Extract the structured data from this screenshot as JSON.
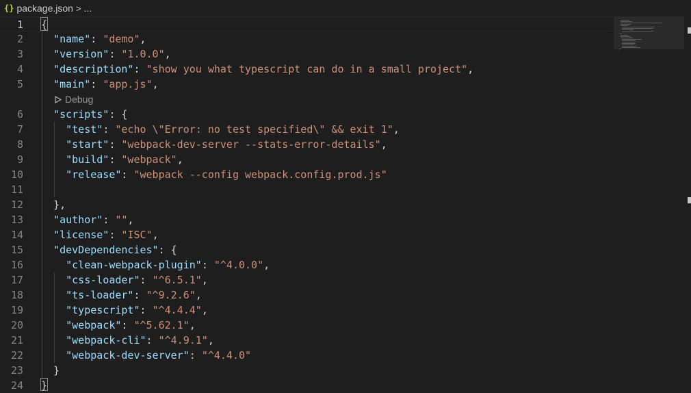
{
  "breadcrumb": {
    "file_icon": "{}",
    "file": "package.json",
    "sep": ">",
    "more": "..."
  },
  "codelens": {
    "debug": "Debug"
  },
  "lines": [
    {
      "n": "1",
      "tokens": [
        {
          "t": "p",
          "v": "{"
        }
      ]
    },
    {
      "n": "2",
      "tokens": [
        {
          "t": "p",
          "v": "  "
        },
        {
          "t": "k",
          "v": "\"name\""
        },
        {
          "t": "p",
          "v": ": "
        },
        {
          "t": "s",
          "v": "\"demo\""
        },
        {
          "t": "p",
          "v": ","
        }
      ]
    },
    {
      "n": "3",
      "tokens": [
        {
          "t": "p",
          "v": "  "
        },
        {
          "t": "k",
          "v": "\"version\""
        },
        {
          "t": "p",
          "v": ": "
        },
        {
          "t": "s",
          "v": "\"1.0.0\""
        },
        {
          "t": "p",
          "v": ","
        }
      ]
    },
    {
      "n": "4",
      "tokens": [
        {
          "t": "p",
          "v": "  "
        },
        {
          "t": "k",
          "v": "\"description\""
        },
        {
          "t": "p",
          "v": ": "
        },
        {
          "t": "s",
          "v": "\"show you what typescript can do in a small project\""
        },
        {
          "t": "p",
          "v": ","
        }
      ]
    },
    {
      "n": "5",
      "tokens": [
        {
          "t": "p",
          "v": "  "
        },
        {
          "t": "k",
          "v": "\"main\""
        },
        {
          "t": "p",
          "v": ": "
        },
        {
          "t": "s",
          "v": "\"app.js\""
        },
        {
          "t": "p",
          "v": ","
        }
      ]
    },
    {
      "n": "6",
      "tokens": [
        {
          "t": "p",
          "v": "  "
        },
        {
          "t": "k",
          "v": "\"scripts\""
        },
        {
          "t": "p",
          "v": ": {"
        }
      ]
    },
    {
      "n": "7",
      "tokens": [
        {
          "t": "p",
          "v": "    "
        },
        {
          "t": "k",
          "v": "\"test\""
        },
        {
          "t": "p",
          "v": ": "
        },
        {
          "t": "s",
          "v": "\"echo \\\"Error: no test specified\\\" && exit 1\""
        },
        {
          "t": "p",
          "v": ","
        }
      ]
    },
    {
      "n": "8",
      "tokens": [
        {
          "t": "p",
          "v": "    "
        },
        {
          "t": "k",
          "v": "\"start\""
        },
        {
          "t": "p",
          "v": ": "
        },
        {
          "t": "s",
          "v": "\"webpack-dev-server --stats-error-details\""
        },
        {
          "t": "p",
          "v": ","
        }
      ]
    },
    {
      "n": "9",
      "tokens": [
        {
          "t": "p",
          "v": "    "
        },
        {
          "t": "k",
          "v": "\"build\""
        },
        {
          "t": "p",
          "v": ": "
        },
        {
          "t": "s",
          "v": "\"webpack\""
        },
        {
          "t": "p",
          "v": ","
        }
      ]
    },
    {
      "n": "10",
      "tokens": [
        {
          "t": "p",
          "v": "    "
        },
        {
          "t": "k",
          "v": "\"release\""
        },
        {
          "t": "p",
          "v": ": "
        },
        {
          "t": "s",
          "v": "\"webpack --config webpack.config.prod.js\""
        }
      ]
    },
    {
      "n": "11",
      "tokens": []
    },
    {
      "n": "12",
      "tokens": [
        {
          "t": "p",
          "v": "  },"
        }
      ]
    },
    {
      "n": "13",
      "tokens": [
        {
          "t": "p",
          "v": "  "
        },
        {
          "t": "k",
          "v": "\"author\""
        },
        {
          "t": "p",
          "v": ": "
        },
        {
          "t": "s",
          "v": "\"\""
        },
        {
          "t": "p",
          "v": ","
        }
      ]
    },
    {
      "n": "14",
      "tokens": [
        {
          "t": "p",
          "v": "  "
        },
        {
          "t": "k",
          "v": "\"license\""
        },
        {
          "t": "p",
          "v": ": "
        },
        {
          "t": "s",
          "v": "\"ISC\""
        },
        {
          "t": "p",
          "v": ","
        }
      ]
    },
    {
      "n": "15",
      "tokens": [
        {
          "t": "p",
          "v": "  "
        },
        {
          "t": "k",
          "v": "\"devDependencies\""
        },
        {
          "t": "p",
          "v": ": {"
        }
      ]
    },
    {
      "n": "16",
      "tokens": [
        {
          "t": "p",
          "v": "    "
        },
        {
          "t": "k",
          "v": "\"clean-webpack-plugin\""
        },
        {
          "t": "p",
          "v": ": "
        },
        {
          "t": "s",
          "v": "\"^4.0.0\""
        },
        {
          "t": "p",
          "v": ","
        }
      ]
    },
    {
      "n": "17",
      "tokens": [
        {
          "t": "p",
          "v": "    "
        },
        {
          "t": "k",
          "v": "\"css-loader\""
        },
        {
          "t": "p",
          "v": ": "
        },
        {
          "t": "s",
          "v": "\"^6.5.1\""
        },
        {
          "t": "p",
          "v": ","
        }
      ]
    },
    {
      "n": "18",
      "tokens": [
        {
          "t": "p",
          "v": "    "
        },
        {
          "t": "k",
          "v": "\"ts-loader\""
        },
        {
          "t": "p",
          "v": ": "
        },
        {
          "t": "s",
          "v": "\"^9.2.6\""
        },
        {
          "t": "p",
          "v": ","
        }
      ]
    },
    {
      "n": "19",
      "tokens": [
        {
          "t": "p",
          "v": "    "
        },
        {
          "t": "k",
          "v": "\"typescript\""
        },
        {
          "t": "p",
          "v": ": "
        },
        {
          "t": "s",
          "v": "\"^4.4.4\""
        },
        {
          "t": "p",
          "v": ","
        }
      ]
    },
    {
      "n": "20",
      "tokens": [
        {
          "t": "p",
          "v": "    "
        },
        {
          "t": "k",
          "v": "\"webpack\""
        },
        {
          "t": "p",
          "v": ": "
        },
        {
          "t": "s",
          "v": "\"^5.62.1\""
        },
        {
          "t": "p",
          "v": ","
        }
      ]
    },
    {
      "n": "21",
      "tokens": [
        {
          "t": "p",
          "v": "    "
        },
        {
          "t": "k",
          "v": "\"webpack-cli\""
        },
        {
          "t": "p",
          "v": ": "
        },
        {
          "t": "s",
          "v": "\"^4.9.1\""
        },
        {
          "t": "p",
          "v": ","
        }
      ]
    },
    {
      "n": "22",
      "tokens": [
        {
          "t": "p",
          "v": "    "
        },
        {
          "t": "k",
          "v": "\"webpack-dev-server\""
        },
        {
          "t": "p",
          "v": ": "
        },
        {
          "t": "s",
          "v": "\"^4.4.0\""
        }
      ]
    },
    {
      "n": "23",
      "tokens": [
        {
          "t": "p",
          "v": "  }"
        }
      ]
    },
    {
      "n": "24",
      "tokens": [
        {
          "t": "p",
          "v": "}"
        }
      ]
    }
  ],
  "active_line": "1",
  "colors": {
    "background": "#1e1e1e",
    "key": "#9cdcfe",
    "string": "#ce9178",
    "punctuation": "#d4d4d4",
    "line_number": "#858585"
  },
  "icons": {
    "file": "json-braces-icon",
    "codelens": "play-outline-icon"
  }
}
